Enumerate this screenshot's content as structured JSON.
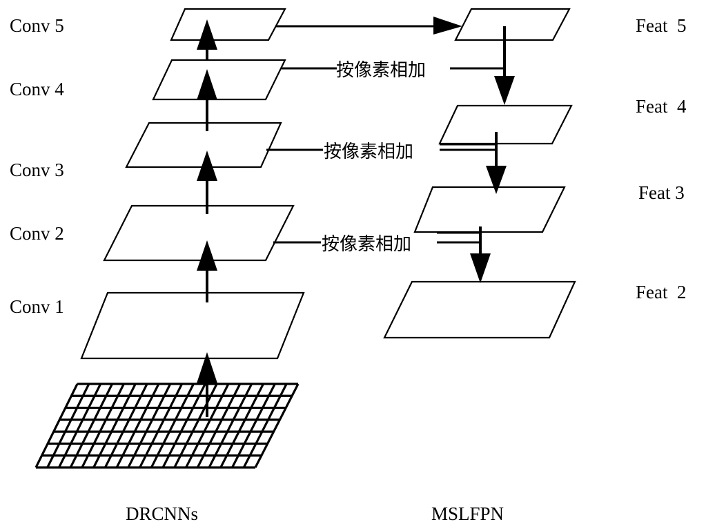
{
  "diagram": {
    "left_column": {
      "caption": "DRCNNs",
      "layers": [
        {
          "label": "Conv 5"
        },
        {
          "label": "Conv 4"
        },
        {
          "label": "Conv 3"
        },
        {
          "label": "Conv 2"
        },
        {
          "label": "Conv 1"
        }
      ],
      "input": "input-grid"
    },
    "right_column": {
      "caption": "MSLFPN",
      "layers": [
        {
          "label": "Feat  5"
        },
        {
          "label": "Feat  4"
        },
        {
          "label": "Feat 3"
        },
        {
          "label": "Feat  2"
        }
      ]
    },
    "merge_labels": [
      "按像素相加",
      "按像素相加",
      "按像素相加"
    ],
    "colors": {
      "stroke": "#000000",
      "background": "#ffffff"
    }
  }
}
